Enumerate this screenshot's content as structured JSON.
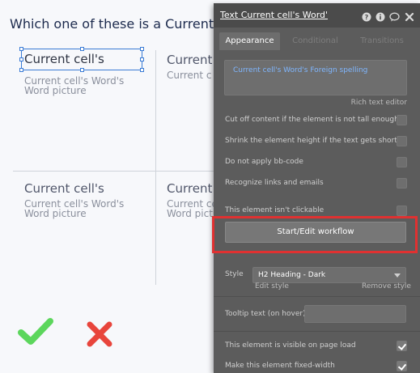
{
  "canvas": {
    "question": "Which one of these is a Current Pa",
    "cells": [
      {
        "title": "Current cell's",
        "subtitle": "Current cell's Word's Word picture"
      },
      {
        "title": "Current",
        "subtitle": "Current cell's"
      },
      {
        "title": "Current cell's",
        "subtitle": "Current cell's Word's Word picture"
      },
      {
        "title": "Current",
        "subtitle": "Current cell's Word's Word picture"
      }
    ],
    "check_color": "#5cd65c",
    "cross_color": "#e8453c"
  },
  "panel": {
    "title": "Text Current cell's Word'",
    "header_icons": [
      "help-icon",
      "info-icon",
      "comment-icon",
      "close-icon"
    ],
    "tabs": [
      {
        "label": "Appearance",
        "active": true
      },
      {
        "label": "Conditional",
        "active": false
      },
      {
        "label": "Transitions",
        "active": false
      }
    ],
    "rich_text_value": "Current cell's Word's Foreign spelling",
    "rich_text_editor_label": "Rich text editor",
    "options": [
      {
        "label": "Cut off content if the element is not tall enough",
        "checked": false
      },
      {
        "label": "Shrink the element height if the text gets shorter",
        "checked": false
      },
      {
        "label": "Do not apply bb-code",
        "checked": false
      },
      {
        "label": "Recognize links and emails",
        "checked": false
      },
      {
        "label": "This element isn't clickable",
        "checked": false
      }
    ],
    "workflow_button": "Start/Edit workflow",
    "style_label": "Style",
    "style_value": "H2 Heading - Dark",
    "edit_style": "Edit style",
    "remove_style": "Remove style",
    "tooltip_label": "Tooltip text (on hover)",
    "tooltip_value": "",
    "visibility_options": [
      {
        "label": "This element is visible on page load",
        "checked": true
      },
      {
        "label": "Make this element fixed-width",
        "checked": true
      }
    ],
    "highlight_color": "#e03131"
  }
}
